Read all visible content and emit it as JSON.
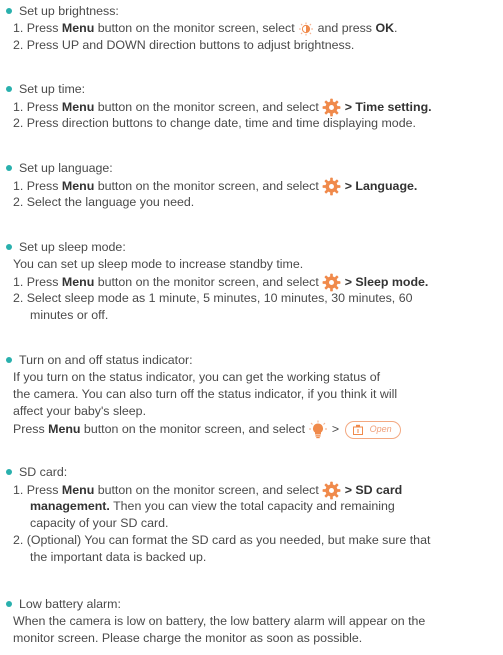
{
  "colors": {
    "bullet": "#29b0ad",
    "icon_orange": "#f08a4b",
    "text": "#4a4a4a"
  },
  "sections": {
    "brightness": {
      "title": "Set up brightness:",
      "s1_pre": "1. Press ",
      "menu": "Menu",
      "s1_mid": " button on the monitor screen, select ",
      "icon": "brightness-icon",
      "s1_post": " and press ",
      "ok": "OK",
      "s1_end": ".",
      "s2": "2. Press UP and DOWN direction buttons to adjust brightness."
    },
    "time": {
      "title": "Set up time:",
      "s1_pre": "1. Press ",
      "menu": "Menu",
      "s1_mid": " button on the monitor screen, and select ",
      "icon": "gear-icon",
      "s1_bold": " > Time setting.",
      "s2": "2. Press direction buttons to change date, time and time displaying mode."
    },
    "language": {
      "title": "Set up language:",
      "s1_pre": "1. Press ",
      "menu": "Menu",
      "s1_mid": " button on the monitor screen, and select ",
      "icon": "gear-icon",
      "s1_bold": " > Language.",
      "s2": "2. Select the language you need."
    },
    "sleep": {
      "title": "Set up sleep mode:",
      "intro": "You can set up sleep mode to increase standby time.",
      "s1_pre": "1. Press ",
      "menu": "Menu",
      "s1_mid": " button on the monitor screen, and select ",
      "icon": "gear-icon",
      "s1_bold": " > Sleep mode.",
      "s2_a": "2. Select sleep mode as 1 minute, 5 minutes, 10 minutes, 30 minutes, 60",
      "s2_b": "minutes or off."
    },
    "status": {
      "title": "Turn on and off status indicator:",
      "p1": "If you turn on the status indicator, you can get the working status of",
      "p2": "the camera. You can also turn off the status indicator, if you think it will",
      "p3": "affect your baby's sleep.",
      "p4_pre": "Press ",
      "menu": "Menu",
      "p4_mid": " button on the monitor screen, and select ",
      "icon": "bulb-icon",
      "sep": " > ",
      "pill_icon": "indicator-icon",
      "pill_text": "Open"
    },
    "sd": {
      "title": "SD card:",
      "s1_pre": "1. Press ",
      "menu": "Menu",
      "s1_mid": " button on the monitor screen, and select ",
      "icon": "gear-icon",
      "s1_bold": " > SD card",
      "s1_bold2": "management.",
      "s1_post": " Then you can view the total capacity and remaining",
      "s1_c": "capacity of your SD card.",
      "s2_a": "2. (Optional) You can format the SD card as you needed, but make sure that",
      "s2_b": "the important data is backed up."
    },
    "battery": {
      "title": "Low battery alarm:",
      "p1": "When the camera is low on battery, the low battery alarm will appear on the",
      "p2": "monitor screen. Please charge the monitor as soon as possible."
    }
  }
}
